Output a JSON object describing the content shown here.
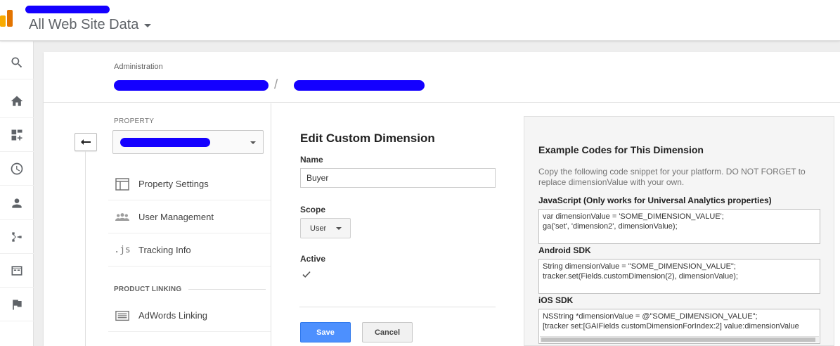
{
  "header": {
    "view_name": "All Web Site Data"
  },
  "rail": {
    "icons": [
      "search-icon",
      "home-icon",
      "dashboard-add-icon",
      "clock-icon",
      "person-icon",
      "fork-icon",
      "window-icon",
      "flag-icon"
    ]
  },
  "admin": {
    "label": "Administration",
    "breadcrumb_separator": "/"
  },
  "left_nav": {
    "property_label": "PROPERTY",
    "items": [
      {
        "label": "Property Settings",
        "icon": "window-icon"
      },
      {
        "label": "User Management",
        "icon": "people-icon"
      },
      {
        "label": "Tracking Info",
        "icon": ".js"
      }
    ],
    "section_label": "PRODUCT LINKING",
    "linking_items": [
      {
        "label": "AdWords Linking",
        "icon": "keyboard-icon"
      }
    ]
  },
  "form": {
    "title": "Edit Custom Dimension",
    "name_label": "Name",
    "name_value": "Buyer",
    "scope_label": "Scope",
    "scope_value": "User",
    "active_label": "Active",
    "active_checked": true,
    "save_label": "Save",
    "cancel_label": "Cancel"
  },
  "example": {
    "title": "Example Codes for This Dimension",
    "description": "Copy the following code snippet for your platform. DO NOT FORGET to replace dimensionValue with your own.",
    "sections": [
      {
        "label": "JavaScript (Only works for Universal Analytics properties)",
        "lines": [
          "var dimensionValue = 'SOME_DIMENSION_VALUE';",
          "ga('set', 'dimension2', dimensionValue);"
        ]
      },
      {
        "label": "Android SDK",
        "lines": [
          "String dimensionValue = \"SOME_DIMENSION_VALUE\";",
          "tracker.set(Fields.customDimension(2), dimensionValue);"
        ]
      },
      {
        "label": "iOS SDK",
        "lines": [
          "NSString *dimensionValue = @\"SOME_DIMENSION_VALUE\";",
          "[tracker set:[GAIFields customDimensionForIndex:2] value:dimensionValue"
        ]
      }
    ]
  },
  "colors": {
    "primary_button": "#4d90fe",
    "redaction": "#1400ff",
    "logo_orange": "#e37400",
    "logo_yellow": "#f9ab00"
  }
}
